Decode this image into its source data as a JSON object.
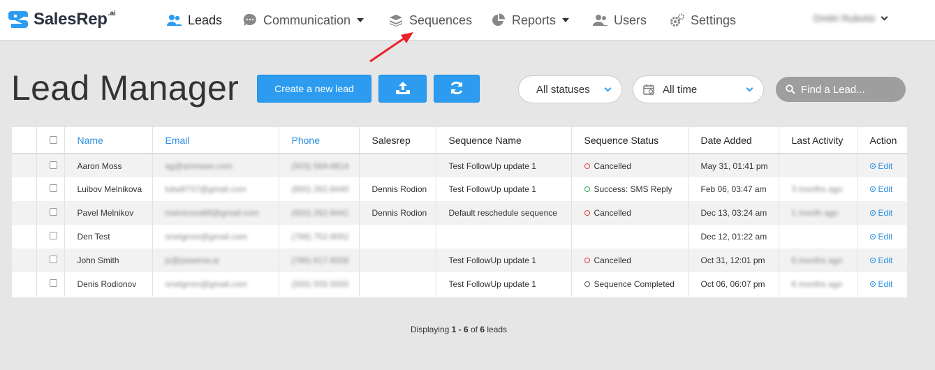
{
  "app": {
    "brand": "SalesRep",
    "brand_suffix": ".ai"
  },
  "nav": {
    "items": [
      {
        "label": "Leads",
        "icon": "users-icon"
      },
      {
        "label": "Communication",
        "icon": "chat-bubble-icon"
      },
      {
        "label": "Sequences",
        "icon": "layers-icon"
      },
      {
        "label": "Reports",
        "icon": "pie-chart-icon"
      },
      {
        "label": "Users",
        "icon": "user-group-icon"
      },
      {
        "label": "Settings",
        "icon": "gear-icon"
      }
    ],
    "user_name": "Dmitri Rubotsi"
  },
  "header": {
    "title": "Lead Manager",
    "create_label": "Create a new lead",
    "status_filter": "All statuses",
    "time_filter": "All time",
    "search_placeholder": "Find a Lead..."
  },
  "table": {
    "columns": [
      "Name",
      "Email",
      "Phone",
      "Salesrep",
      "Sequence Name",
      "Sequence Status",
      "Date Added",
      "Last Activity",
      "Action"
    ],
    "rows": [
      {
        "name": "Aaron Moss",
        "email": "ag@anmews.com",
        "phone": "(503) 569-8814",
        "salesrep": "",
        "sequence": "Test FollowUp update 1",
        "status": "Cancelled",
        "status_type": "cancel",
        "date": "May 31, 01:41 pm",
        "activity": "",
        "action": "Edit"
      },
      {
        "name": "Luibov Melnikova",
        "email": "luba9737@gmail.com",
        "phone": "(650) 262-8440",
        "salesrep": "Dennis Rodion",
        "sequence": "Test FollowUp update 1",
        "status": "Success: SMS Reply",
        "status_type": "success",
        "date": "Feb 06, 03:47 am",
        "activity": "3 months ago",
        "action": "Edit"
      },
      {
        "name": "Pavel Melnikov",
        "email": "melnicova88@gmail.com",
        "phone": "(650) 262-8441",
        "salesrep": "Dennis Rodion",
        "sequence": "Default reschedule sequence",
        "status": "Cancelled",
        "status_type": "cancel",
        "date": "Dec 13, 03:24 am",
        "activity": "1 month ago",
        "action": "Edit"
      },
      {
        "name": "Den Test",
        "email": "onetgrom@gmail.com",
        "phone": "(786) 752-9052",
        "salesrep": "",
        "sequence": "",
        "status": "",
        "status_type": "",
        "date": "Dec 12, 01:22 am",
        "activity": "",
        "action": "Edit"
      },
      {
        "name": "John Smith",
        "email": "js@pewenw.ai",
        "phone": "(786) 617-6556",
        "salesrep": "",
        "sequence": "Test FollowUp update 1",
        "status": "Cancelled",
        "status_type": "cancel",
        "date": "Oct 31, 12:01 pm",
        "activity": "6 months ago",
        "action": "Edit"
      },
      {
        "name": "Denis Rodionov",
        "email": "onetgrom@gmail.com",
        "phone": "(555) 555-5555",
        "salesrep": "",
        "sequence": "Test FollowUp update 1",
        "status": "Sequence Completed",
        "status_type": "done",
        "date": "Oct 06, 06:07 pm",
        "activity": "6 months ago",
        "action": "Edit"
      }
    ]
  },
  "footer": {
    "prefix": "Displaying ",
    "range": "1 - 6",
    "middle": " of ",
    "total": "6",
    "suffix": " leads"
  },
  "colors": {
    "accent": "#2d9cf0",
    "cancel": "#e0433b",
    "success": "#36a852",
    "annotation": "#e8232a"
  }
}
